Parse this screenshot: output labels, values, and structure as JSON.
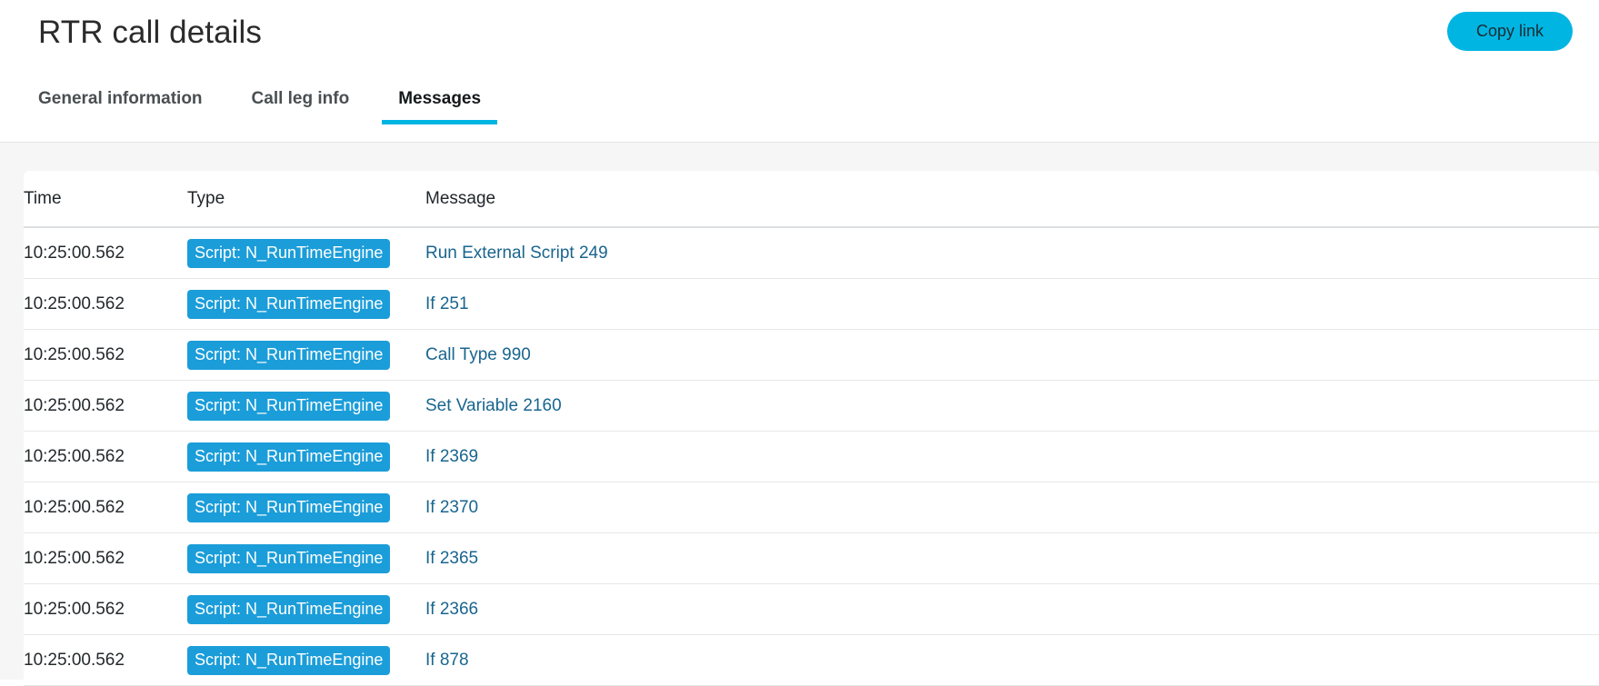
{
  "header": {
    "title": "RTR call details",
    "copy_link_label": "Copy link",
    "accent_color": "#00b5e2"
  },
  "tabs": [
    {
      "label": "General information",
      "active": false
    },
    {
      "label": "Call leg info",
      "active": false
    },
    {
      "label": "Messages",
      "active": true
    }
  ],
  "table": {
    "columns": [
      "Time",
      "Type",
      "Message"
    ],
    "rows": [
      {
        "time": "10:25:00.562",
        "type": "Script: N_RunTimeEngine",
        "message": "Run External Script 249"
      },
      {
        "time": "10:25:00.562",
        "type": "Script: N_RunTimeEngine",
        "message": "If 251"
      },
      {
        "time": "10:25:00.562",
        "type": "Script: N_RunTimeEngine",
        "message": "Call Type 990"
      },
      {
        "time": "10:25:00.562",
        "type": "Script: N_RunTimeEngine",
        "message": "Set Variable 2160"
      },
      {
        "time": "10:25:00.562",
        "type": "Script: N_RunTimeEngine",
        "message": "If 2369"
      },
      {
        "time": "10:25:00.562",
        "type": "Script: N_RunTimeEngine",
        "message": "If 2370"
      },
      {
        "time": "10:25:00.562",
        "type": "Script: N_RunTimeEngine",
        "message": "If 2365"
      },
      {
        "time": "10:25:00.562",
        "type": "Script: N_RunTimeEngine",
        "message": "If 2366"
      },
      {
        "time": "10:25:00.562",
        "type": "Script: N_RunTimeEngine",
        "message": "If 878"
      }
    ],
    "badge_color": "#1b9dd9",
    "link_color": "#19658f"
  }
}
